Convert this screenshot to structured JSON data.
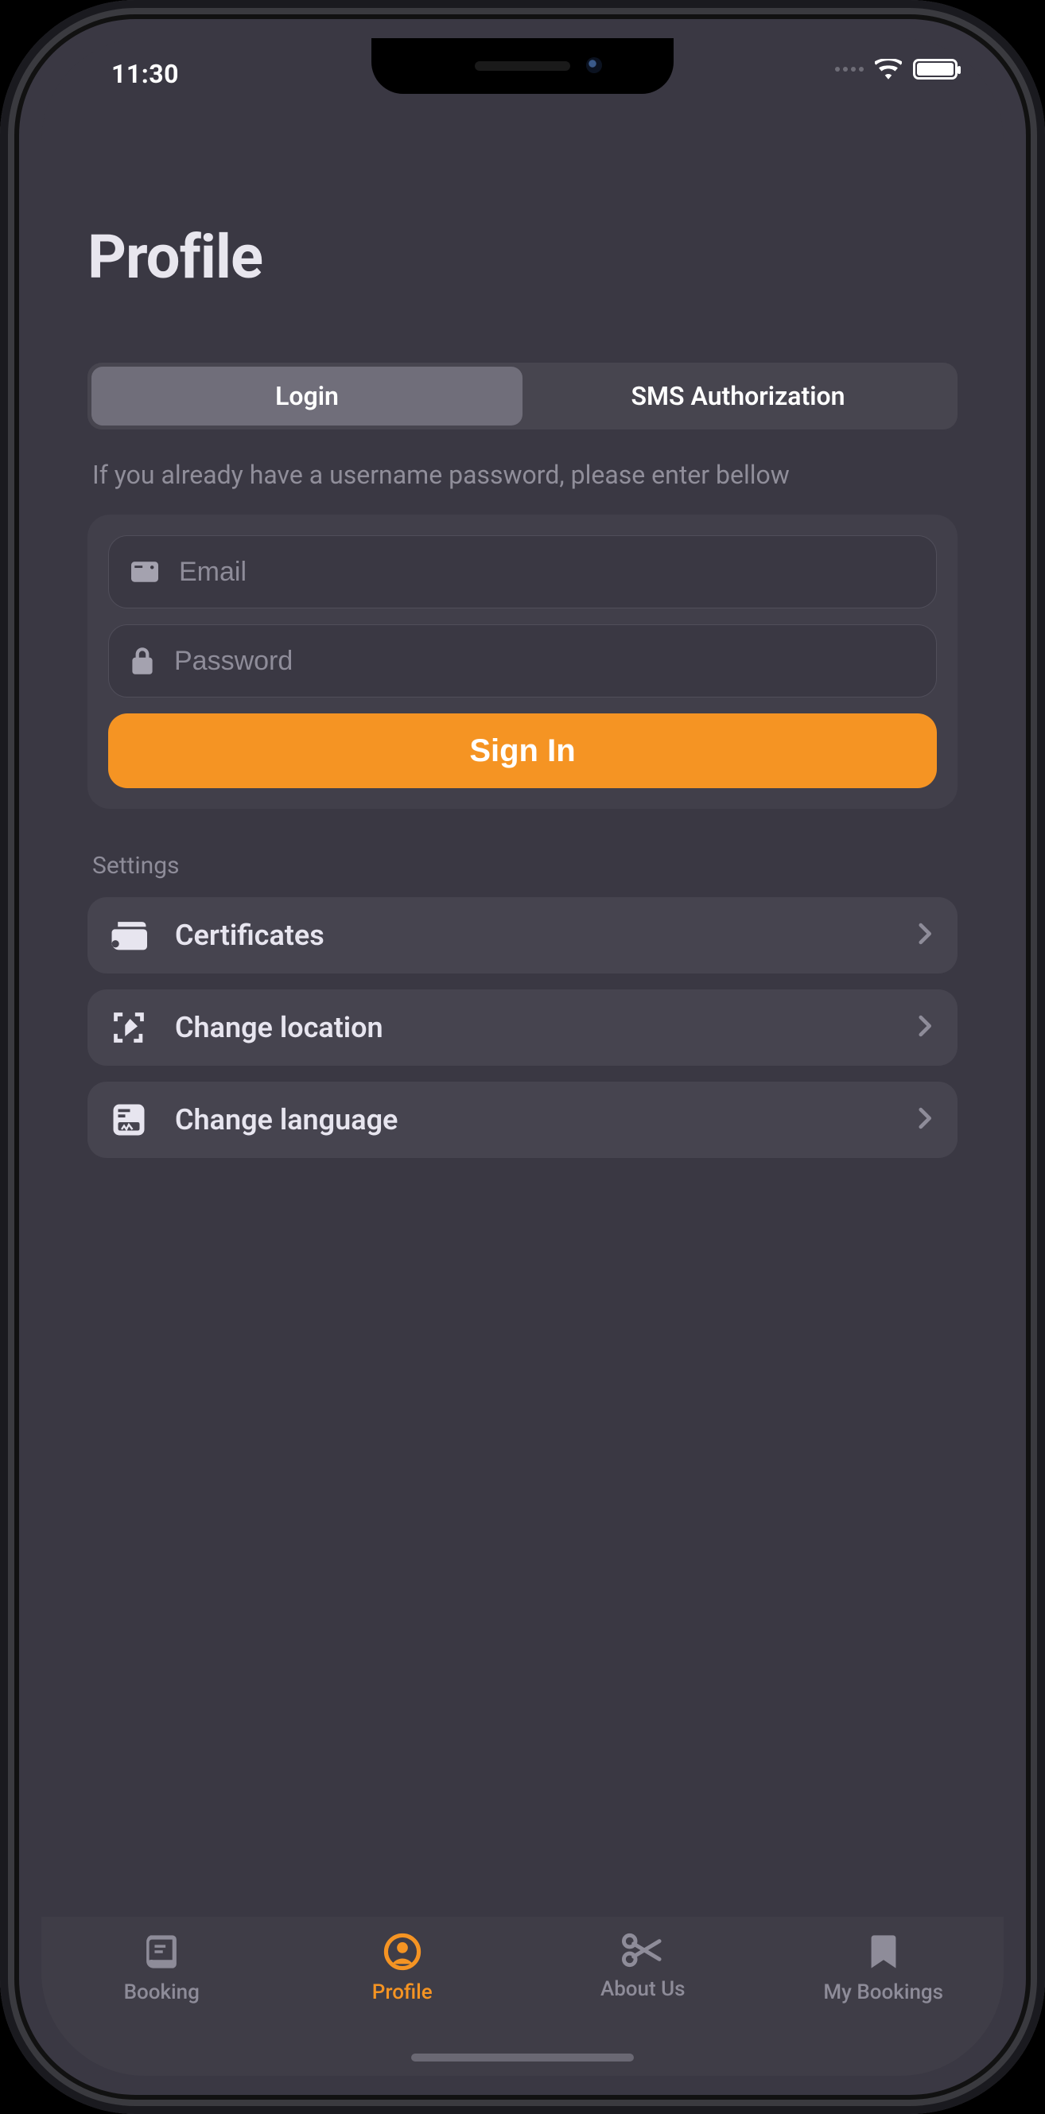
{
  "status": {
    "time": "11:30"
  },
  "page": {
    "title": "Profile"
  },
  "tabs_auth": {
    "login": "Login",
    "sms": "SMS Authorization",
    "active": "login"
  },
  "hint": "If you already have a username password, please enter bellow",
  "form": {
    "email_placeholder": "Email",
    "password_placeholder": "Password",
    "submit_label": "Sign In"
  },
  "settings": {
    "label": "Settings",
    "items": [
      {
        "icon": "wallet-icon",
        "label": "Certificates"
      },
      {
        "icon": "location-icon",
        "label": "Change location"
      },
      {
        "icon": "language-icon",
        "label": "Change language"
      }
    ]
  },
  "navbar": {
    "items": [
      {
        "icon": "book-icon",
        "label": "Booking",
        "active": false
      },
      {
        "icon": "profile-icon",
        "label": "Profile",
        "active": true
      },
      {
        "icon": "scissors-icon",
        "label": "About Us",
        "active": false
      },
      {
        "icon": "bookmark-icon",
        "label": "My Bookings",
        "active": false
      }
    ]
  },
  "colors": {
    "accent": "#f59423",
    "bg": "#3a3843"
  }
}
